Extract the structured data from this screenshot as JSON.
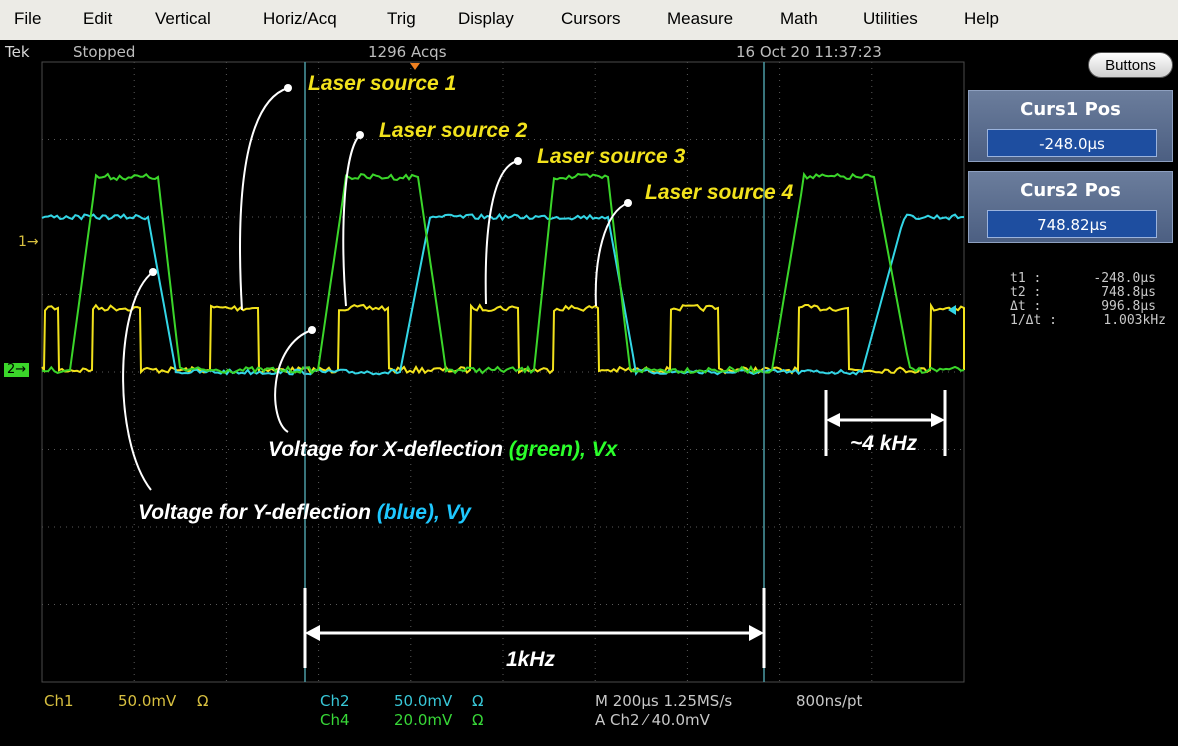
{
  "menu": {
    "items": [
      "File",
      "Edit",
      "Vertical",
      "Horiz/Acq",
      "Trig",
      "Display",
      "Cursors",
      "Measure",
      "Math",
      "Utilities",
      "Help"
    ]
  },
  "status": {
    "brand": "Tek",
    "state": "Stopped",
    "acqs": "1296 Acqs",
    "datetime": "16 Oct 20 11:37:23"
  },
  "right_panel": {
    "buttons_label": "Buttons",
    "curs1": {
      "title": "Curs1 Pos",
      "value": "-248.0µs"
    },
    "curs2": {
      "title": "Curs2 Pos",
      "value": "748.82µs"
    },
    "measurements": [
      {
        "label": "t1 :",
        "value": "-248.0µs"
      },
      {
        "label": "t2 :",
        "value": "748.8µs"
      },
      {
        "label": "Δt :",
        "value": "996.8µs"
      },
      {
        "label": "1/Δt :",
        "value": "1.003kHz"
      }
    ]
  },
  "channel_markers": {
    "ch1": "1",
    "ch2": "2"
  },
  "bottom": {
    "ch1": {
      "name": "Ch1",
      "scale": "50.0mV",
      "coupling": "Ω"
    },
    "ch2": {
      "name": "Ch2",
      "scale": "50.0mV",
      "coupling": "Ω"
    },
    "ch4": {
      "name": "Ch4",
      "scale": "20.0mV",
      "coupling": "Ω"
    },
    "timebase": "M 200µs 1.25MS/s",
    "resolution": "800ns/pt",
    "trigger": "A  Ch2  ⁄  40.0mV"
  },
  "annotations": {
    "laser1": "Laser source 1",
    "laser2": "Laser source 2",
    "laser3": "Laser source 3",
    "laser4": "Laser source 4",
    "vx_text": "Voltage for X-deflection",
    "vx_color": "(green), Vx",
    "vy_text": "Voltage for Y-deflection",
    "vy_color": "(blue), Vy",
    "freq_4k": "~4 kHz",
    "freq_1k": "1kHz"
  },
  "colors": {
    "yellow_trace": "#f2e21c",
    "green_trace": "#3bd62a",
    "cyan_trace": "#33d6e6",
    "grid": "#5a5a5a",
    "cursor_line": "#4a9aa4",
    "annotation_yellow": "#f2e21c",
    "annotation_green": "#2bff2b",
    "annotation_cyan": "#1ec8ff",
    "channel1_text": "#d8c040",
    "channel2_text": "#38c8d8",
    "channel4_text": "#38d838"
  }
}
